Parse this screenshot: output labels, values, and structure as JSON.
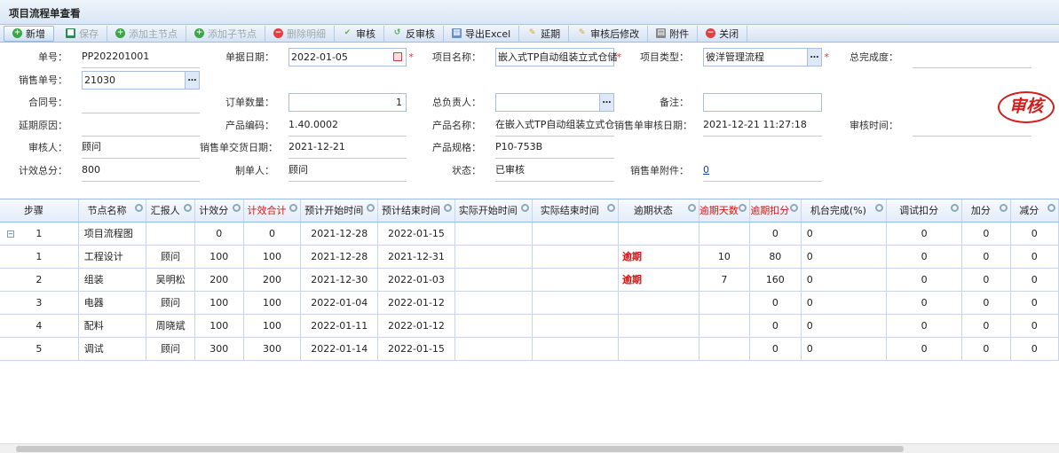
{
  "title": "项目流程单查看",
  "toolbar": [
    {
      "label": "新增",
      "icon": "add-icon",
      "color": "#3aa845",
      "disabled": false
    },
    {
      "label": "保存",
      "icon": "save-icon",
      "color": "#2e8b57",
      "disabled": true
    },
    {
      "label": "添加主节点",
      "icon": "add-icon",
      "color": "#3aa845",
      "disabled": true
    },
    {
      "label": "添加子节点",
      "icon": "add-icon",
      "color": "#3aa845",
      "disabled": true
    },
    {
      "label": "删除明细",
      "icon": "delete-icon",
      "color": "#e04040",
      "disabled": true
    },
    {
      "label": "审核",
      "icon": "check-icon",
      "color": "#6ab04c",
      "disabled": false
    },
    {
      "label": "反审核",
      "icon": "undo-icon",
      "color": "#4caf50",
      "disabled": false
    },
    {
      "label": "导出Excel",
      "icon": "table-icon",
      "color": "#6b8fc7",
      "disabled": false
    },
    {
      "label": "延期",
      "icon": "pencil-icon",
      "color": "#e0a020",
      "disabled": false
    },
    {
      "label": "审核后修改",
      "icon": "pencil-icon",
      "color": "#e0a020",
      "disabled": false
    },
    {
      "label": "附件",
      "icon": "attachment-icon",
      "color": "#888888",
      "disabled": false
    },
    {
      "label": "关闭",
      "icon": "close-icon",
      "color": "#e04040",
      "disabled": false
    }
  ],
  "form": [
    [
      {
        "label": "单号：",
        "value": "PP202201001"
      },
      {
        "label": "单据日期：",
        "value": "2022-01-05",
        "type": "date",
        "req": true
      },
      {
        "label": "项目名称：",
        "value": "嵌入式TP自动组装立式仓储",
        "type": "input",
        "req": true
      },
      {
        "label": "项目类型：",
        "value": "彼洋管理流程",
        "type": "lookup",
        "req": true
      },
      {
        "label": "总完成度：",
        "value": ""
      }
    ],
    [
      {
        "label": "销售单号：",
        "value": "21030",
        "type": "lookup"
      },
      null,
      null,
      null,
      null
    ],
    [
      {
        "label": "合同号：",
        "value": ""
      },
      {
        "label": "订单数量：",
        "value": "1",
        "type": "input",
        "right": true
      },
      {
        "label": "总负责人：",
        "value": "",
        "type": "lookup"
      },
      {
        "label": "备注：",
        "value": "",
        "type": "input"
      },
      null
    ],
    [
      {
        "label": "延期原因：",
        "value": ""
      },
      {
        "label": "产品编码：",
        "value": "1.40.0002"
      },
      {
        "label": "产品名称：",
        "value": "在嵌入式TP自动组装立式仓"
      },
      {
        "label": "销售单审核日期：",
        "value": "2021-12-21 11:27:18"
      },
      {
        "label": "审核时间：",
        "value": ""
      }
    ],
    [
      {
        "label": "审核人：",
        "value": "顾问"
      },
      {
        "label": "销售单交货日期：",
        "value": "2021-12-21"
      },
      {
        "label": "产品规格：",
        "value": "P10-753B"
      },
      null,
      null
    ],
    [
      {
        "label": "计效总分：",
        "value": "800"
      },
      {
        "label": "制单人：",
        "value": "顾问"
      },
      {
        "label": "状态：",
        "value": "已审核"
      },
      {
        "label": "销售单附件：",
        "value": "0",
        "type": "link"
      },
      null
    ]
  ],
  "stamp": "审核",
  "grid": {
    "columns": [
      {
        "label": "步骤",
        "w": 90,
        "search": false
      },
      {
        "label": "节点名称",
        "w": 77
      },
      {
        "label": "汇报人",
        "w": 55
      },
      {
        "label": "计效分",
        "w": 55
      },
      {
        "label": "计效合计",
        "w": 65,
        "red": true
      },
      {
        "label": "预计开始时间",
        "w": 87
      },
      {
        "label": "预计结束时间",
        "w": 87
      },
      {
        "label": "实际开始时间",
        "w": 87
      },
      {
        "label": "实际结束时间",
        "w": 98
      },
      {
        "label": "逾期状态",
        "w": 92
      },
      {
        "label": "逾期天数",
        "w": 55,
        "red": true
      },
      {
        "label": "逾期扣分",
        "w": 58,
        "red": true
      },
      {
        "label": "机台完成(%)",
        "w": 97
      },
      {
        "label": "调试扣分",
        "w": 86
      },
      {
        "label": "加分",
        "w": 55
      },
      {
        "label": "减分",
        "w": 55
      }
    ],
    "rows": [
      {
        "parent": true,
        "cells": [
          "1",
          "项目流程图",
          "",
          "0",
          "0",
          "2021-12-28",
          "2022-01-15",
          "",
          "",
          "",
          "",
          "0",
          "0",
          "0",
          "0",
          "0"
        ]
      },
      {
        "cells": [
          "1",
          "工程设计",
          "顾问",
          "100",
          "100",
          "2021-12-28",
          "2021-12-31",
          "",
          "",
          "逾期",
          "10",
          "80",
          "0",
          "0",
          "0",
          "0"
        ]
      },
      {
        "cells": [
          "2",
          "组装",
          "吴明松",
          "200",
          "200",
          "2021-12-30",
          "2022-01-03",
          "",
          "",
          "逾期",
          "7",
          "160",
          "0",
          "0",
          "0",
          "0"
        ]
      },
      {
        "cells": [
          "3",
          "电器",
          "顾问",
          "100",
          "100",
          "2022-01-04",
          "2022-01-12",
          "",
          "",
          "",
          "",
          "0",
          "0",
          "0",
          "0",
          "0"
        ]
      },
      {
        "cells": [
          "4",
          "配料",
          "周晓斌",
          "100",
          "100",
          "2022-01-11",
          "2022-01-12",
          "",
          "",
          "",
          "",
          "0",
          "0",
          "0",
          "0",
          "0"
        ]
      },
      {
        "cells": [
          "5",
          "调试",
          "顾问",
          "300",
          "300",
          "2022-01-14",
          "2022-01-15",
          "",
          "",
          "",
          "",
          "0",
          "0",
          "0",
          "0",
          "0"
        ]
      }
    ]
  }
}
